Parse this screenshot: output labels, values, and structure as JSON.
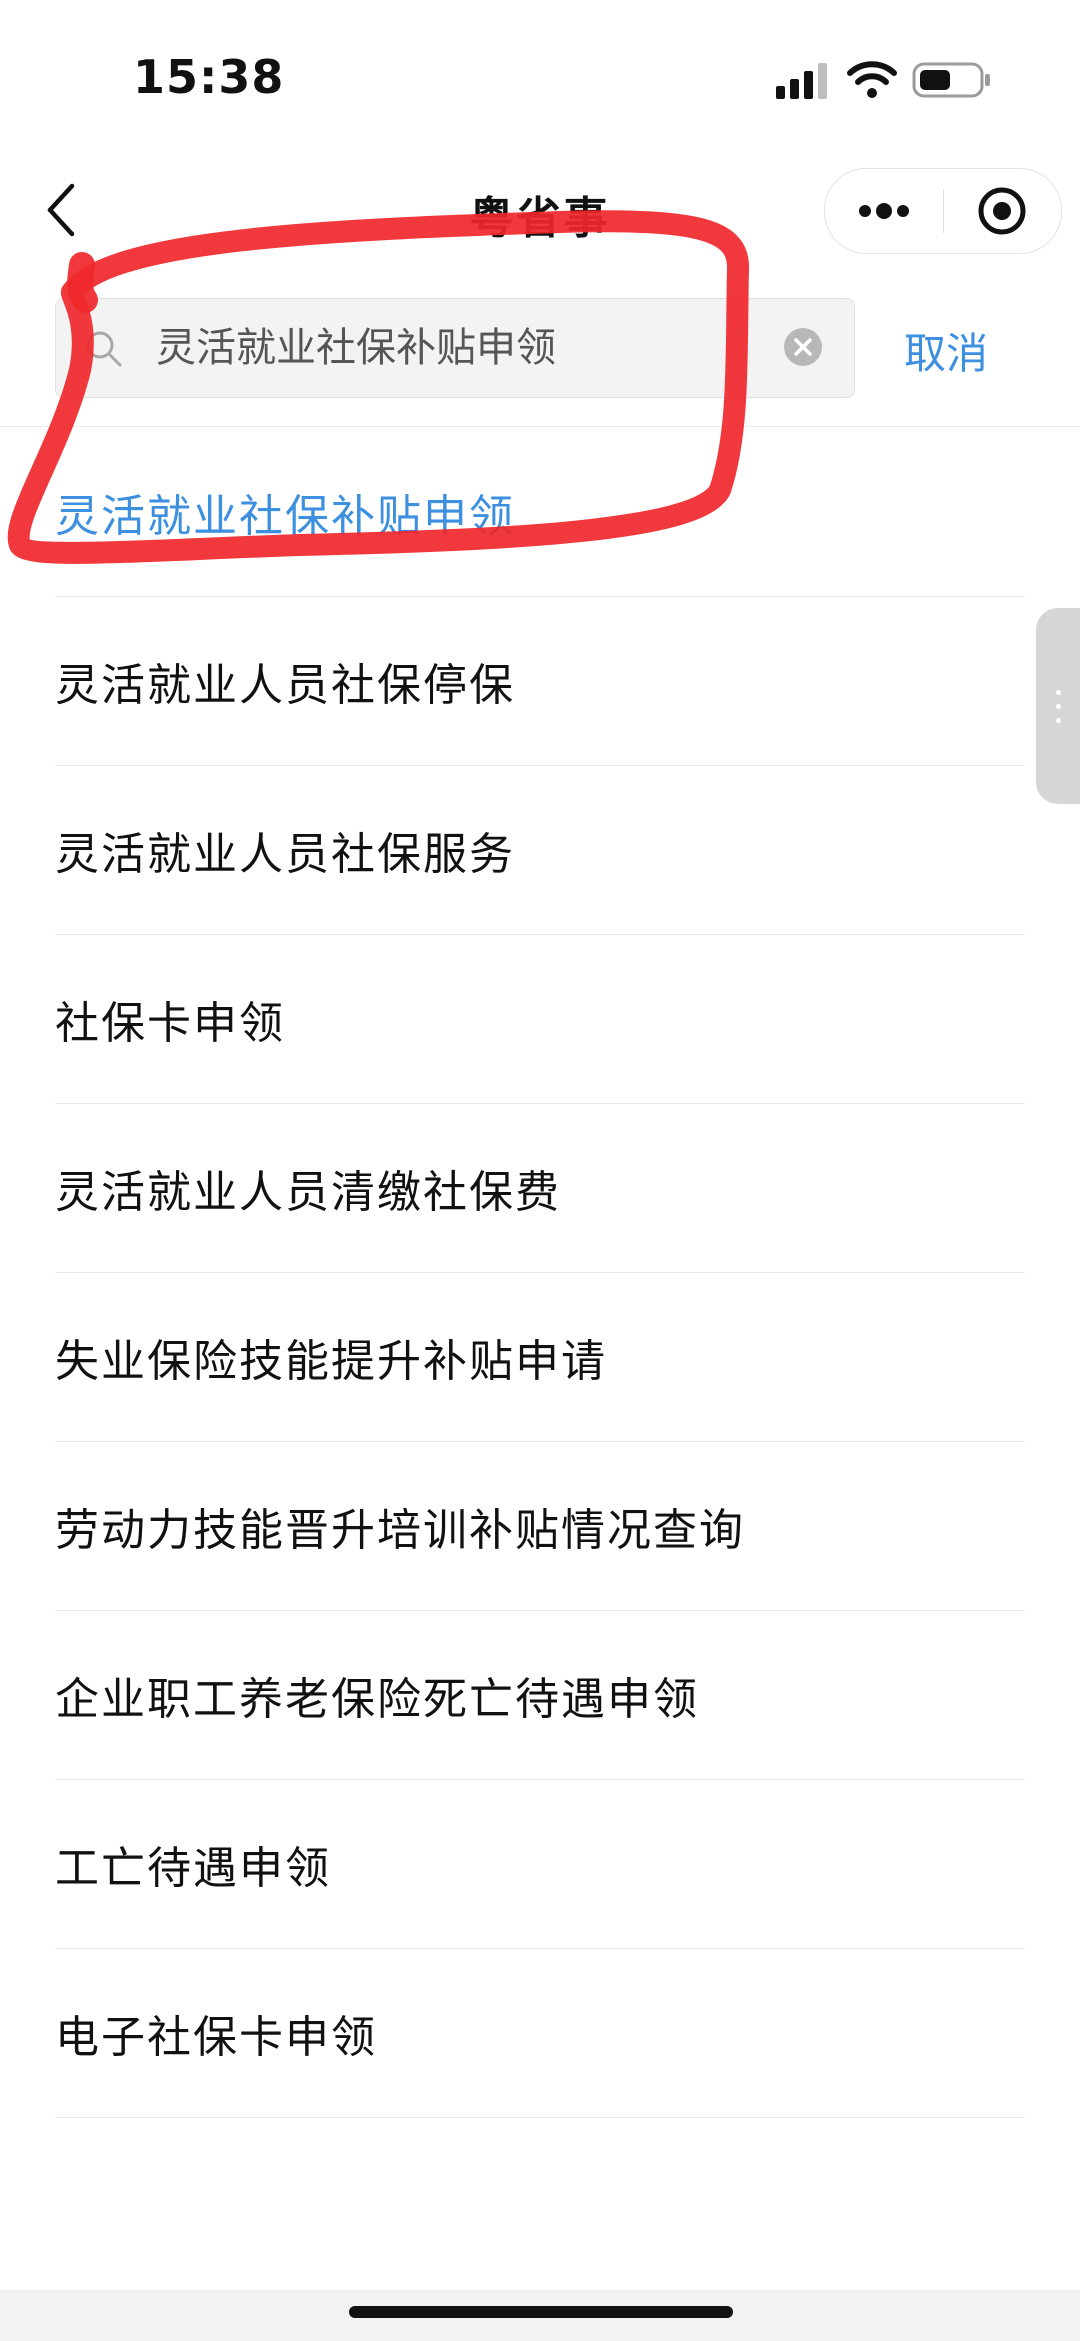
{
  "status_bar": {
    "time": "15:38"
  },
  "nav": {
    "title": "粤省事"
  },
  "search": {
    "value": "灵活就业社保补贴申领",
    "cancel_label": "取消"
  },
  "results": [
    {
      "label": "灵活就业社保补贴申领",
      "highlighted": true
    },
    {
      "label": "灵活就业人员社保停保"
    },
    {
      "label": "灵活就业人员社保服务"
    },
    {
      "label": "社保卡申领"
    },
    {
      "label": "灵活就业人员清缴社保费"
    },
    {
      "label": "失业保险技能提升补贴申请"
    },
    {
      "label": "劳动力技能晋升培训补贴情况查询"
    },
    {
      "label": "企业职工养老保险死亡待遇申领"
    },
    {
      "label": "工亡待遇申领"
    },
    {
      "label": "电子社保卡申领"
    }
  ],
  "colors": {
    "accent": "#3d8fe0",
    "annotation": "#f0282d"
  },
  "icons": [
    "back-icon",
    "more-dots-icon",
    "target-icon",
    "search-icon",
    "clear-icon"
  ]
}
